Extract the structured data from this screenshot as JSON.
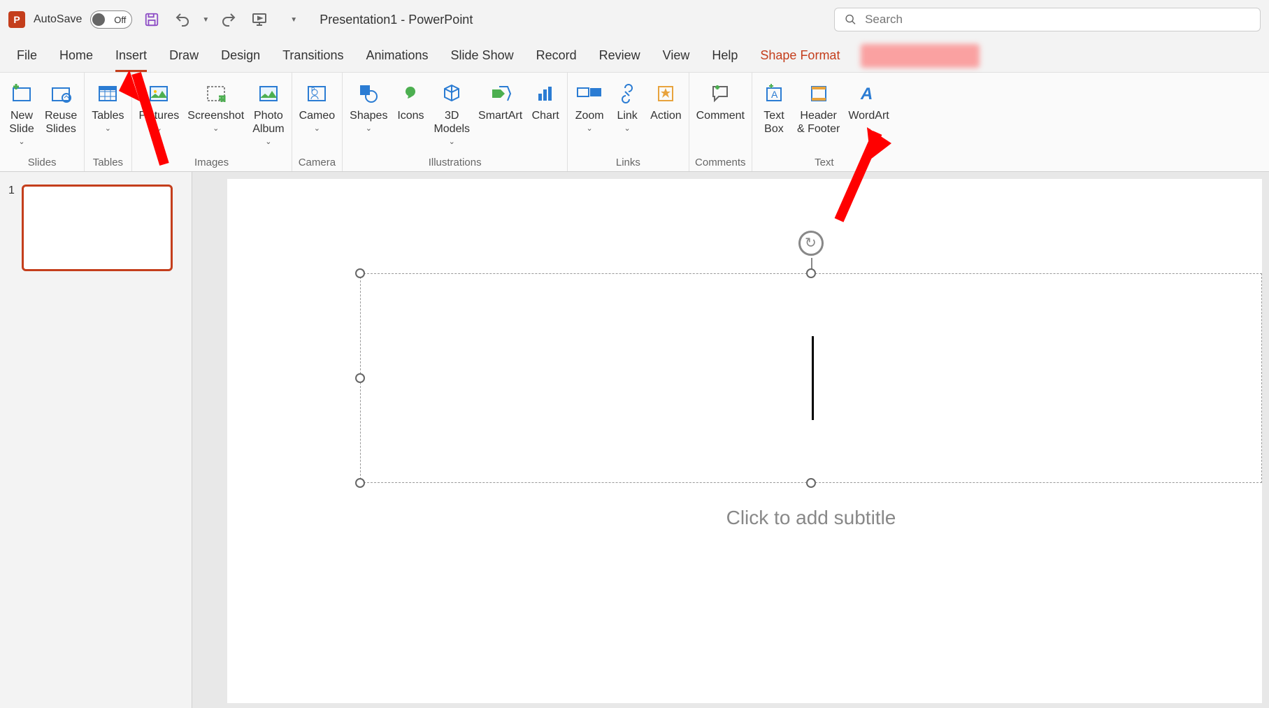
{
  "titlebar": {
    "autosave_label": "AutoSave",
    "autosave_state": "Off",
    "doc_title": "Presentation1  -  PowerPoint",
    "search_placeholder": "Search"
  },
  "tabs": {
    "file": "File",
    "home": "Home",
    "insert": "Insert",
    "draw": "Draw",
    "design": "Design",
    "transitions": "Transitions",
    "animations": "Animations",
    "slideshow": "Slide Show",
    "record": "Record",
    "review": "Review",
    "view": "View",
    "help": "Help",
    "shape_format": "Shape Format"
  },
  "ribbon": {
    "groups": {
      "slides": "Slides",
      "tables": "Tables",
      "images": "Images",
      "camera": "Camera",
      "illustrations": "Illustrations",
      "links": "Links",
      "comments": "Comments",
      "text": "Text"
    },
    "buttons": {
      "new_slide": "New\nSlide",
      "reuse_slides": "Reuse\nSlides",
      "tables": "Tables",
      "pictures": "Pictures",
      "screenshot": "Screenshot",
      "photo_album": "Photo\nAlbum",
      "cameo": "Cameo",
      "shapes": "Shapes",
      "icons": "Icons",
      "models_3d": "3D\nModels",
      "smartart": "SmartArt",
      "chart": "Chart",
      "zoom": "Zoom",
      "link": "Link",
      "action": "Action",
      "comment": "Comment",
      "text_box": "Text\nBox",
      "header_footer": "Header\n& Footer",
      "wordart": "WordArt"
    }
  },
  "slide_panel": {
    "slide_number": "1"
  },
  "canvas": {
    "subtitle_placeholder": "Click to add subtitle"
  }
}
